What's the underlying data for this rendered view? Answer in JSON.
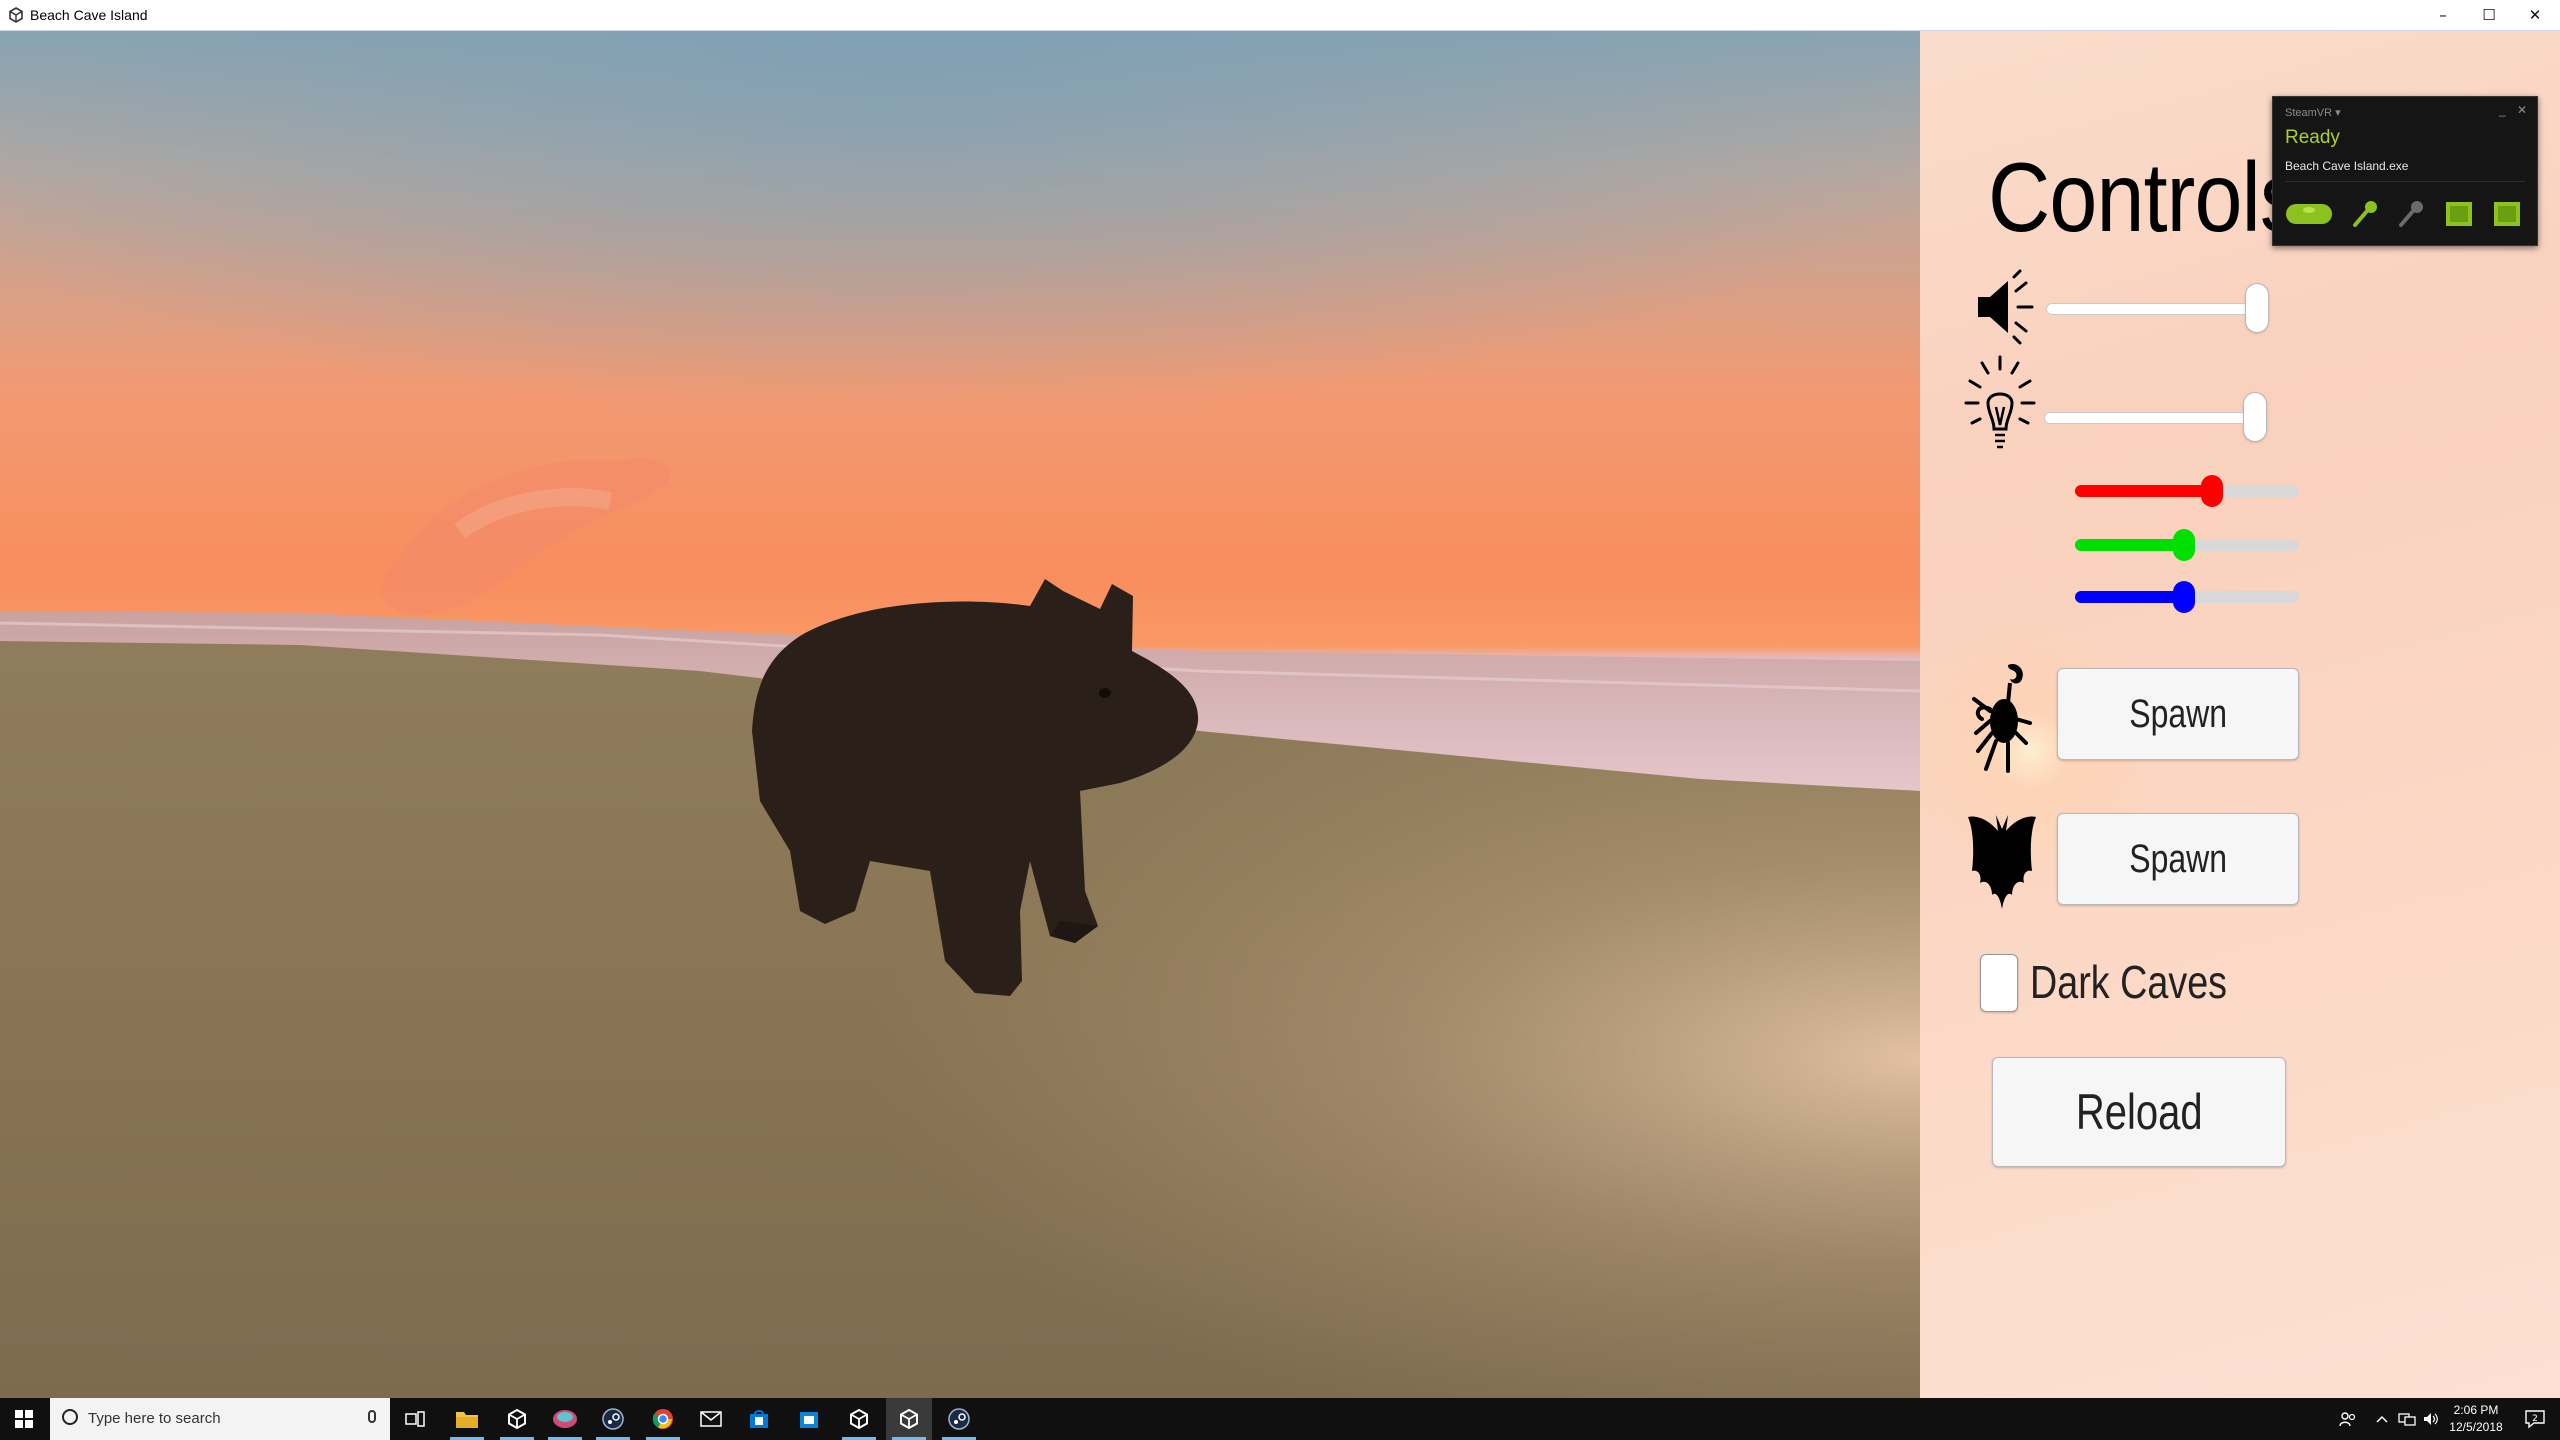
{
  "window": {
    "title": "Beach Cave Island",
    "app_icon": "unity-icon",
    "minimize_glyph": "–",
    "maximize_glyph": "☐",
    "close_glyph": "✕"
  },
  "panel": {
    "title": "Controls",
    "volume": {
      "icon": "speaker-icon",
      "value_percent": 100
    },
    "brightness": {
      "icon": "lightbulb-icon",
      "value_percent": 100
    },
    "color": {
      "red": {
        "value_percent": 59,
        "color": "#ff0000"
      },
      "green": {
        "value_percent": 47,
        "color": "#00e000"
      },
      "blue": {
        "value_percent": 47,
        "color": "#0000ff"
      }
    },
    "crab_spawn": {
      "icon": "crab-icon",
      "label": "Spawn"
    },
    "bat_spawn": {
      "icon": "bat-icon",
      "label": "Spawn"
    },
    "dark_caves": {
      "label": "Dark Caves",
      "checked": false
    },
    "reload": {
      "label": "Reload"
    }
  },
  "steamvr": {
    "brand": "SteamVR ▾",
    "minimize": "_",
    "close": "✕",
    "status": "Ready",
    "app": "Beach Cave Island.exe",
    "accent": "#a9d22f",
    "devices": [
      "headset-icon",
      "controller-icon",
      "controller-off-icon",
      "base-station-icon",
      "base-station-icon"
    ]
  },
  "taskbar": {
    "search_placeholder": "Type here to search",
    "apps": [
      "task-view-icon",
      "file-explorer-icon",
      "unity-icon",
      "gitkraken-icon",
      "steam-icon",
      "chrome-icon",
      "mail-icon",
      "store-icon",
      "store-icon",
      "unity-icon",
      "unity-active-icon",
      "steam-icon"
    ],
    "time": "2:06 PM",
    "date": "12/5/2018",
    "notifications": "2"
  }
}
